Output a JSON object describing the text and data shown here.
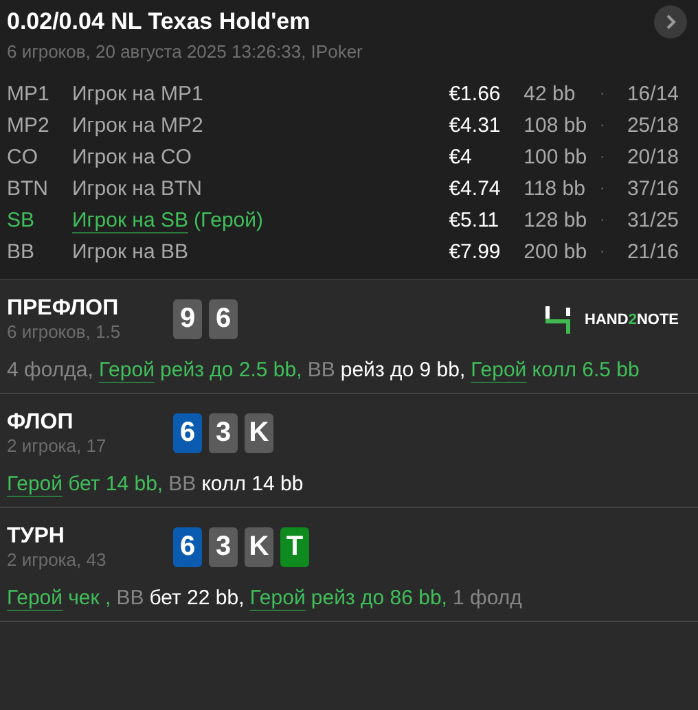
{
  "header": {
    "title": "0.02/0.04 NL Texas Hold'em",
    "subtitle": "6 игроков, 20 августа 2025 13:26:33, IPoker"
  },
  "players": [
    {
      "position": "MP1",
      "name": "Игрок на MP1",
      "hero": false,
      "stack": "€1.66",
      "bb": "42 bb",
      "separator": "·",
      "stats": "16/14"
    },
    {
      "position": "MP2",
      "name": "Игрок на MP2",
      "hero": false,
      "stack": "€4.31",
      "bb": "108 bb",
      "separator": "·",
      "stats": "25/18"
    },
    {
      "position": "CO",
      "name": "Игрок на CO",
      "hero": false,
      "stack": "€4",
      "bb": "100 bb",
      "separator": "·",
      "stats": "20/18"
    },
    {
      "position": "BTN",
      "name": "Игрок на BTN",
      "hero": false,
      "stack": "€4.74",
      "bb": "118 bb",
      "separator": "·",
      "stats": "37/16"
    },
    {
      "position": "SB",
      "name": "Игрок на SB",
      "hero": true,
      "hero_tag": "(Герой)",
      "stack": "€5.11",
      "bb": "128 bb",
      "separator": "·",
      "stats": "31/25"
    },
    {
      "position": "BB",
      "name": "Игрок на BB",
      "hero": false,
      "stack": "€7.99",
      "bb": "200 bb",
      "separator": "·",
      "stats": "21/16"
    }
  ],
  "streets": [
    {
      "name": "ПРЕФЛОП",
      "info": "6 игроков, 1.5",
      "cards": [
        {
          "rank": "9",
          "color": "#5b5b5b"
        },
        {
          "rank": "6",
          "color": "#5b5b5b"
        }
      ],
      "logo": [
        "HAND",
        "2",
        "NOTE"
      ],
      "actions": [
        {
          "kind": "plain",
          "text": "4 фолда,"
        },
        {
          "kind": "hero",
          "actor": "Герой",
          "text": "рейз до 2.5 bb,"
        },
        {
          "kind": "player",
          "actor": "BB",
          "text": "рейз до 9 bb,"
        },
        {
          "kind": "hero",
          "actor": "Герой",
          "text": "колл 6.5 bb"
        }
      ]
    },
    {
      "name": "ФЛОП",
      "info": "2 игрока, 17",
      "cards": [
        {
          "rank": "6",
          "color": "#0b5bb0"
        },
        {
          "rank": "3",
          "color": "#5b5b5b"
        },
        {
          "rank": "K",
          "color": "#5b5b5b"
        }
      ],
      "actions": [
        {
          "kind": "hero",
          "actor": "Герой",
          "text": "бет 14 bb,"
        },
        {
          "kind": "player",
          "actor": "BB",
          "text": "колл 14 bb"
        }
      ]
    },
    {
      "name": "ТУРН",
      "info": "2 игрока, 43",
      "cards": [
        {
          "rank": "6",
          "color": "#0b5bb0"
        },
        {
          "rank": "3",
          "color": "#5b5b5b"
        },
        {
          "rank": "K",
          "color": "#5b5b5b"
        },
        {
          "rank": "T",
          "color": "#0e8a1e"
        }
      ],
      "actions": [
        {
          "kind": "hero",
          "actor": "Герой",
          "text": "чек ,"
        },
        {
          "kind": "player",
          "actor": "BB",
          "text": "бет 22 bb,"
        },
        {
          "kind": "hero",
          "actor": "Герой",
          "text": "рейз до 86 bb,"
        },
        {
          "kind": "plain",
          "text": "1 фолд"
        }
      ]
    }
  ]
}
